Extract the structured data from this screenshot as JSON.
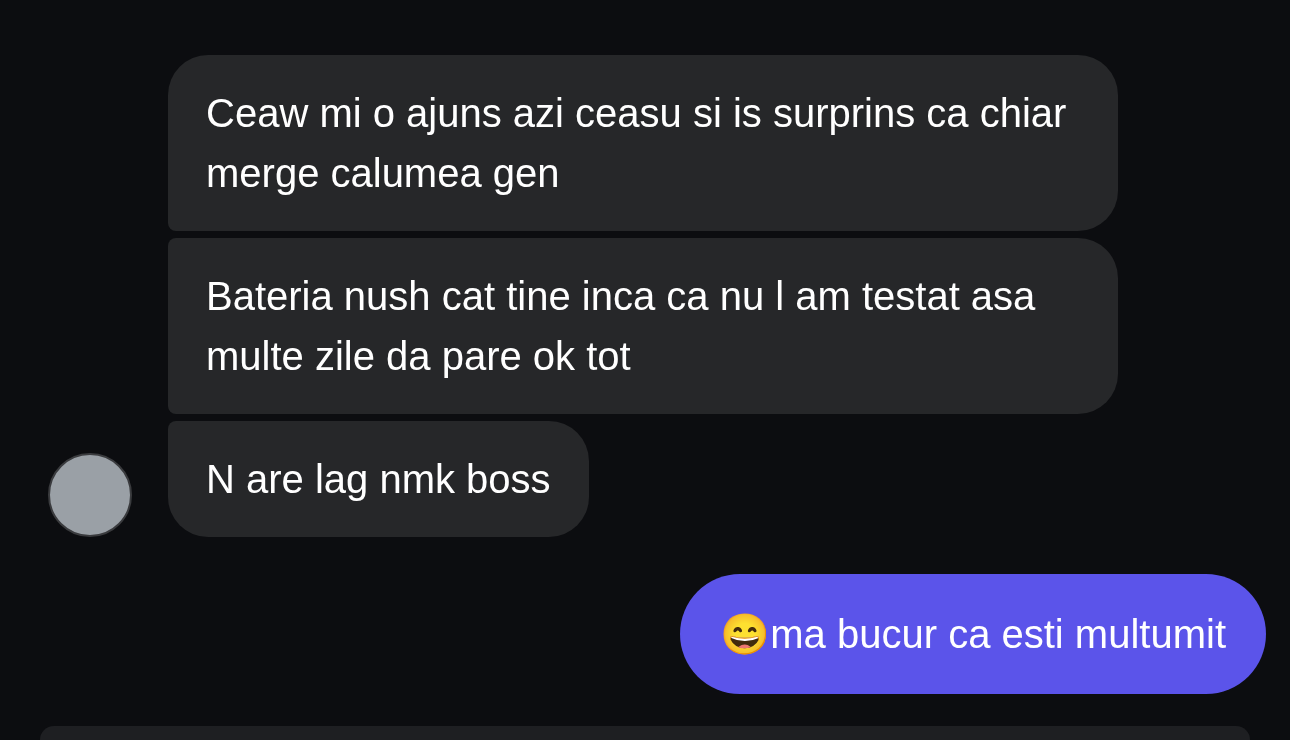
{
  "messages": [
    {
      "kind": "received",
      "text": "Ceaw mi o ajuns azi ceasu si is surprins ca chiar merge calumea gen"
    },
    {
      "kind": "received",
      "text": "Bateria nush cat tine inca ca nu l am testat asa multe zile da pare ok tot"
    },
    {
      "kind": "received",
      "text": "N are lag nmk boss"
    },
    {
      "kind": "sent",
      "text": "😄ma bucur ca esti multumit"
    }
  ]
}
